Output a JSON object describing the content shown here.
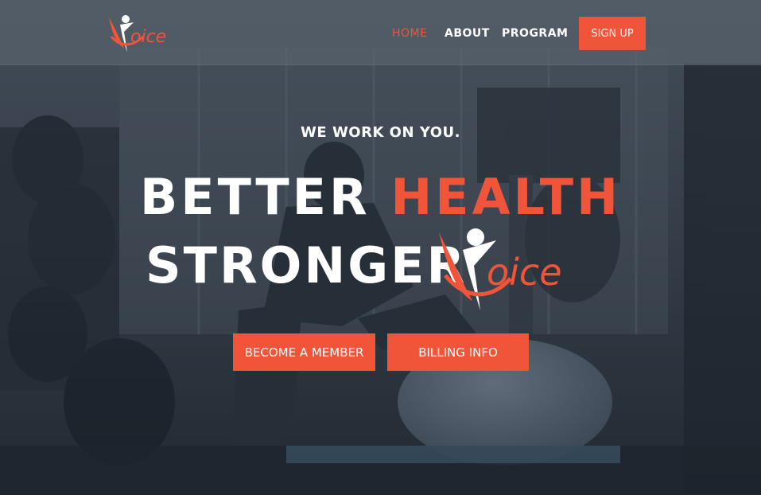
{
  "brand": {
    "logo_text": "oice",
    "accent": "#f0553a"
  },
  "nav": {
    "items": [
      {
        "label": "HOME",
        "active": true
      },
      {
        "label": "ABOUT",
        "active": false
      },
      {
        "label": "PROGRAM",
        "active": false
      }
    ],
    "signup_label": "SIGN UP"
  },
  "hero": {
    "tagline": "WE WORK ON YOU.",
    "line1_white": "BETTER",
    "line1_accent": "HEALTH",
    "line2_white": "STRONGER",
    "cta_primary": "BECOME A MEMBER",
    "cta_secondary": "BILLING INFO"
  }
}
